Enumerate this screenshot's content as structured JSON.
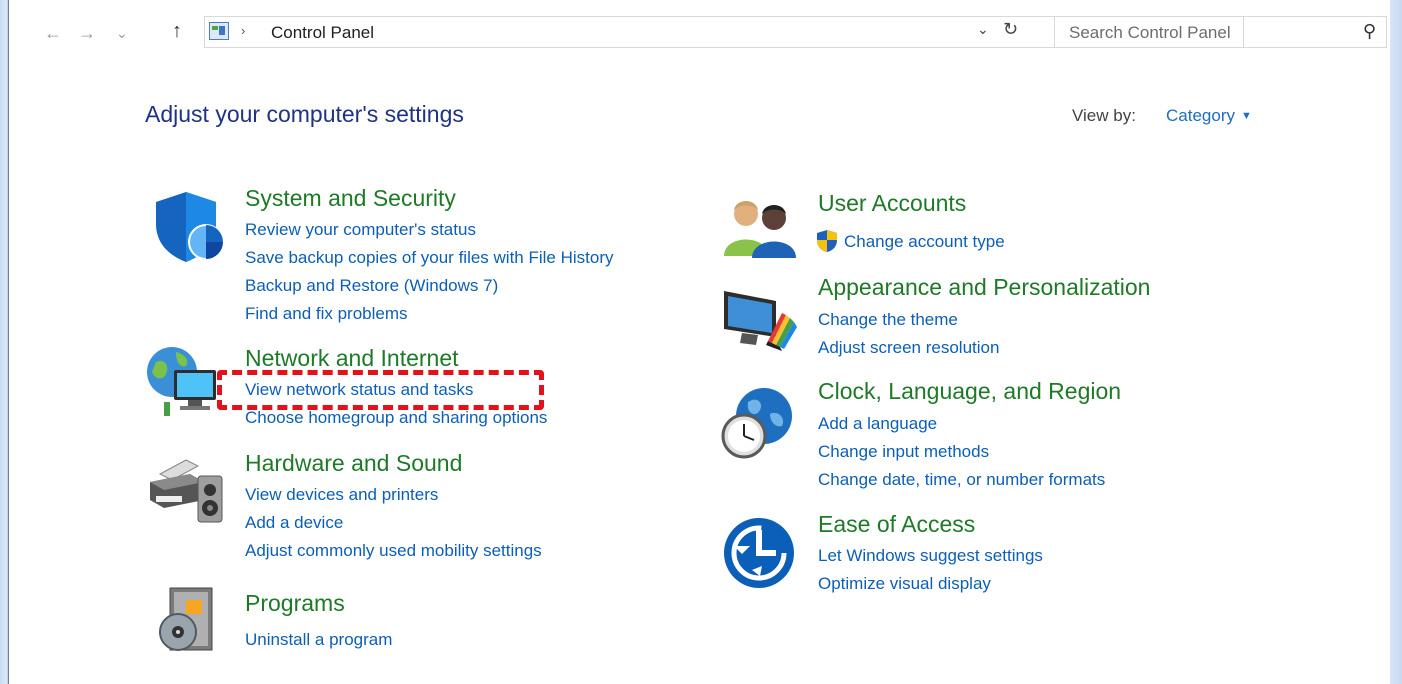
{
  "window": {
    "address_path": "Control Panel",
    "address_separator": "›",
    "search_placeholder": "Search Control Panel"
  },
  "nav": {
    "back_icon": "←",
    "forward_icon": "→",
    "recent_icon": "⌄",
    "up_icon": "↑",
    "dropdown_icon": "⌄",
    "refresh_icon": "↻",
    "search_icon": "⚲"
  },
  "header": {
    "title": "Adjust your computer's settings",
    "view_by_label": "View by:",
    "view_by_value": "Category"
  },
  "categories": [
    {
      "title": "System and Security",
      "links": [
        "Review your computer's status",
        "Save backup copies of your files with File History",
        "Backup and Restore (Windows 7)",
        "Find and fix problems"
      ]
    },
    {
      "title": "Network and Internet",
      "links": [
        "View network status and tasks",
        "Choose homegroup and sharing options"
      ]
    },
    {
      "title": "Hardware and Sound",
      "links": [
        "View devices and printers",
        "Add a device",
        "Adjust commonly used mobility settings"
      ]
    },
    {
      "title": "Programs",
      "links": [
        "Uninstall a program"
      ]
    },
    {
      "title": "User Accounts",
      "links": [
        "Change account type"
      ]
    },
    {
      "title": "Appearance and Personalization",
      "links": [
        "Change the theme",
        "Adjust screen resolution"
      ]
    },
    {
      "title": "Clock, Language, and Region",
      "links": [
        "Add a language",
        "Change input methods",
        "Change date, time, or number formats"
      ]
    },
    {
      "title": "Ease of Access",
      "links": [
        "Let Windows suggest settings",
        "Optimize visual display"
      ]
    }
  ],
  "colors": {
    "category_title": "#1e7a27",
    "link": "#0b5fb8",
    "page_title": "#1e3287",
    "highlight": "#e3121a"
  }
}
